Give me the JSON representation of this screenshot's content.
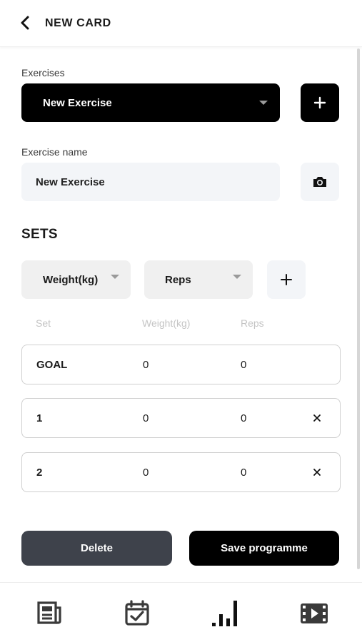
{
  "header": {
    "title": "NEW CARD",
    "back_icon": "chevron-left-icon"
  },
  "exercises": {
    "label": "Exercises",
    "selected": "New Exercise",
    "add_icon": "plus-icon"
  },
  "exercise_name": {
    "label": "Exercise name",
    "value": "New Exercise",
    "camera_icon": "camera-icon"
  },
  "sets": {
    "title": "SETS",
    "column_selects": [
      "Weight(kg)",
      "Reps"
    ],
    "add_icon": "plus-icon",
    "columns": [
      "Set",
      "Weight(kg)",
      "Reps"
    ],
    "rows": [
      {
        "set": "GOAL",
        "weight": "0",
        "reps": "0",
        "removable": false
      },
      {
        "set": "1",
        "weight": "0",
        "reps": "0",
        "removable": true
      },
      {
        "set": "2",
        "weight": "0",
        "reps": "0",
        "removable": true
      }
    ]
  },
  "actions": {
    "delete_label": "Delete",
    "save_label": "Save programme"
  },
  "tabbar": {
    "items": [
      "news-icon",
      "calendar-check-icon",
      "bar-chart-icon",
      "video-icon"
    ]
  },
  "colors": {
    "primary": "#000000",
    "delete": "#3e424b",
    "input_bg": "#f3f5f8",
    "muted": "#c4c4c4"
  }
}
